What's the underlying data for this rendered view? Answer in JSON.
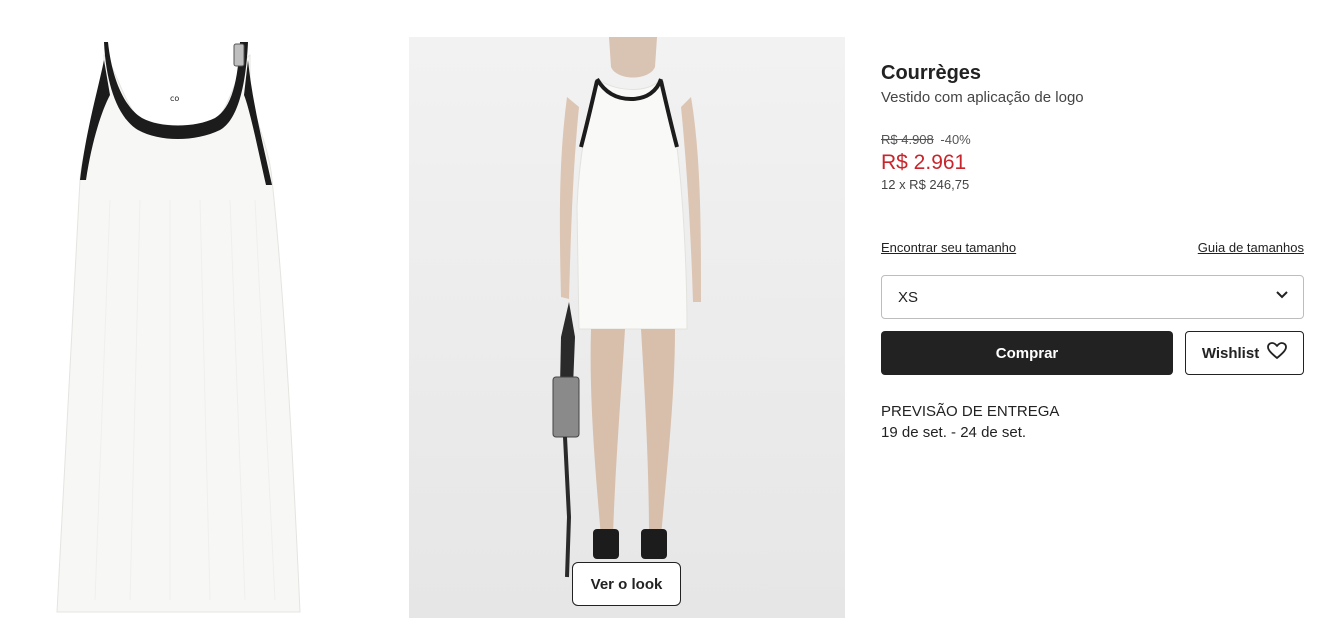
{
  "gallery": {
    "look_button_label": "Ver o look",
    "logo_text": "ᴄᴏ"
  },
  "product": {
    "brand": "Courrèges",
    "description": "Vestido com aplicação de logo",
    "old_price": "R$ 4.908",
    "discount": "-40%",
    "price": "R$ 2.961",
    "installments": "12 x R$ 246,75",
    "price_color": "#c8252c"
  },
  "size": {
    "find_size_link": "Encontrar seu tamanho",
    "size_guide_link": "Guia de tamanhos",
    "selected": "XS",
    "chevron_icon": "chevron-down-icon"
  },
  "actions": {
    "buy_label": "Comprar",
    "wishlist_label": "Wishlist",
    "wishlist_icon": "heart-icon"
  },
  "delivery": {
    "title": "PREVISÃO DE ENTREGA",
    "dates": "19 de set. - 24 de set."
  }
}
